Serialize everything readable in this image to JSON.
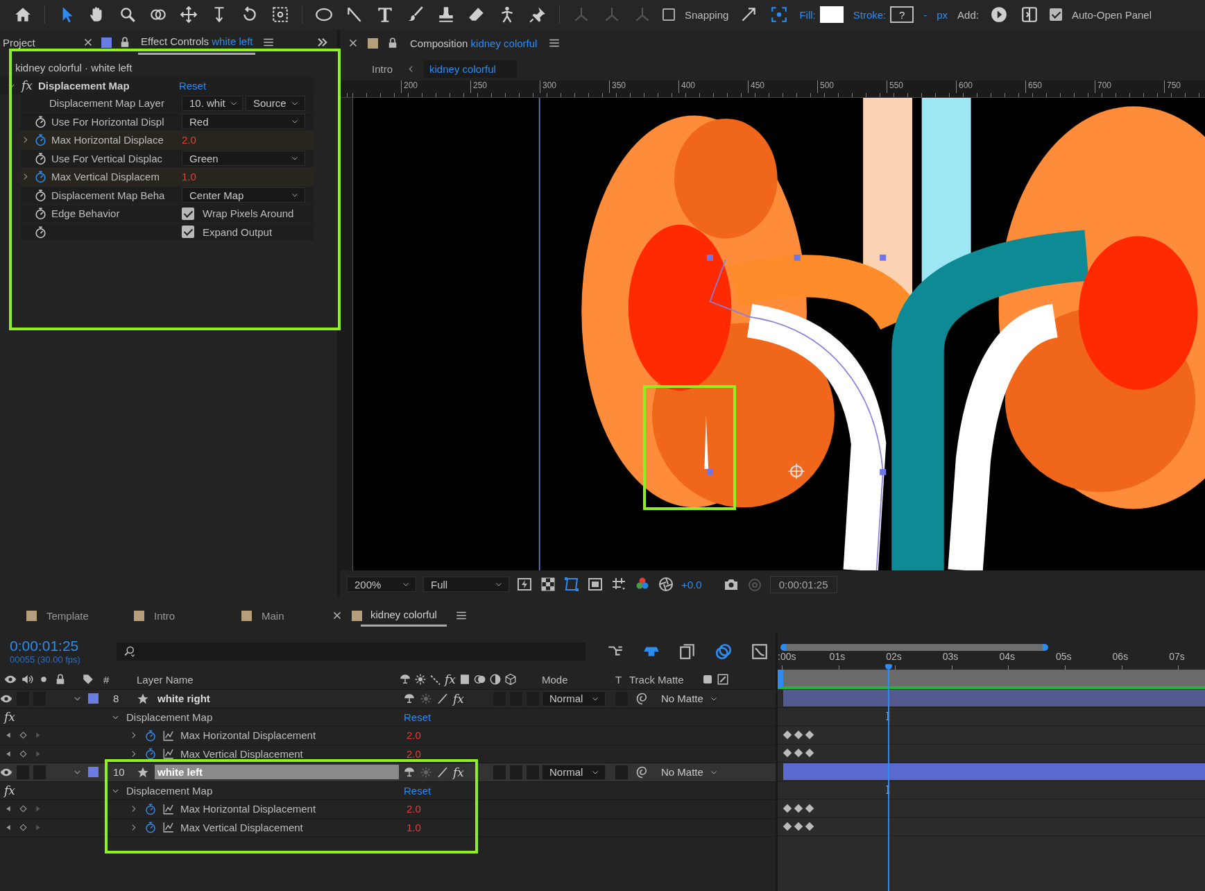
{
  "toolbar": {
    "tools": [
      {
        "kind": "home",
        "selected": false
      },
      {
        "kind": "arrow",
        "selected": true
      },
      {
        "kind": "hand",
        "selected": false
      },
      {
        "kind": "magnifier",
        "selected": false
      },
      {
        "kind": "orbit",
        "selected": false
      },
      {
        "kind": "move",
        "selected": false
      },
      {
        "kind": "dolly",
        "selected": false
      },
      {
        "kind": "rotate",
        "selected": false
      },
      {
        "kind": "anchor",
        "selected": false
      },
      {
        "kind": "ellipse",
        "selected": false
      },
      {
        "kind": "pen",
        "selected": false
      },
      {
        "kind": "type",
        "selected": false
      },
      {
        "kind": "brush",
        "selected": false
      },
      {
        "kind": "stamp",
        "selected": false
      },
      {
        "kind": "eraser",
        "selected": false
      },
      {
        "kind": "figure",
        "selected": false
      },
      {
        "kind": "pin",
        "selected": false
      }
    ],
    "snapping": {
      "label": "Snapping",
      "checked": false
    },
    "fill_label": "Fill:",
    "stroke_label": "Stroke:",
    "stroke_value": "?",
    "stroke_dash": "-",
    "stroke_unit": "px",
    "add_label": "Add:",
    "auto_open": {
      "label": "Auto-Open Panel",
      "checked": true
    }
  },
  "effect_panel": {
    "tabs": [
      {
        "label": "Project",
        "selected": false
      },
      {
        "label": "Effect Controls",
        "layer": "white left",
        "selected": true
      }
    ],
    "breadcrumb": "kidney colorful · white left",
    "effect": {
      "fx": "fx",
      "name": "Displacement Map",
      "reset": "Reset",
      "properties": [
        {
          "kind": "layer_select",
          "label": "Displacement Map Layer",
          "layer": "10. whit",
          "source": "Source"
        },
        {
          "kind": "dropdown",
          "label": "Use For Horizontal Displ",
          "value": "Red",
          "keyframed": false
        },
        {
          "kind": "number",
          "label": "Max Horizontal Displace",
          "value": "2.0",
          "keyframed": true
        },
        {
          "kind": "dropdown",
          "label": "Use For Vertical Displac",
          "value": "Green",
          "keyframed": false
        },
        {
          "kind": "number",
          "label": "Max Vertical Displacem",
          "value": "1.0",
          "keyframed": true
        },
        {
          "kind": "dropdown",
          "label": "Displacement Map Beha",
          "value": "Center Map",
          "keyframed": false
        },
        {
          "kind": "checkbox",
          "label": "Edge Behavior",
          "value": "Wrap Pixels Around",
          "checked": true,
          "keyframed": false
        },
        {
          "kind": "checkbox",
          "value": "Expand Output",
          "checked": true,
          "keyframed": false
        }
      ]
    }
  },
  "viewer": {
    "tab": {
      "label": "Composition",
      "comp": "kidney colorful"
    },
    "breadcrumb": [
      {
        "label": "Intro",
        "selected": false
      },
      {
        "label": "kidney colorful",
        "selected": true
      }
    ],
    "ruler": [
      "200",
      "250",
      "300",
      "350",
      "400",
      "450",
      "500",
      "550",
      "600",
      "650",
      "700",
      "750"
    ],
    "zoom": "200%",
    "resolution": "Full",
    "exposure": "+0.0",
    "timecode": "0:00:01:25"
  },
  "timeline": {
    "tabs": [
      {
        "label": "Template",
        "selected": false
      },
      {
        "label": "Intro",
        "selected": false
      },
      {
        "label": "Main",
        "selected": false
      },
      {
        "label": "kidney colorful",
        "selected": true
      }
    ],
    "timecode": "0:00:01:25",
    "frame_info": "00055 (30.00 fps)",
    "columns": {
      "number": "#",
      "layer_name": "Layer Name",
      "fx": "fx",
      "mode": "Mode",
      "t": "T",
      "track_matte": "Track Matte"
    },
    "time_ruler": [
      ":00s",
      "01s",
      "02s",
      "03s",
      "04s",
      "05s",
      "06s",
      "07s"
    ],
    "layers": [
      {
        "number": "8",
        "name": "white right",
        "selected": false,
        "fx_switch": "fx",
        "mode": "Normal",
        "matte": "No Matte",
        "effect": {
          "fx": "fx",
          "name": "Displacement Map",
          "reset": "Reset",
          "properties": [
            {
              "name": "Max Horizontal Displacement",
              "value": "2.0"
            },
            {
              "name": "Max Vertical Displacement",
              "value": "2.0"
            }
          ]
        }
      },
      {
        "number": "10",
        "name": "white left",
        "selected": true,
        "fx_switch": "fx",
        "mode": "Normal",
        "matte": "No Matte",
        "effect": {
          "fx": "fx",
          "name": "Displacement Map",
          "reset": "Reset",
          "properties": [
            {
              "name": "Max Horizontal Displacement",
              "value": "2.0"
            },
            {
              "name": "Max Vertical Displacement",
              "value": "1.0"
            }
          ]
        }
      }
    ]
  }
}
